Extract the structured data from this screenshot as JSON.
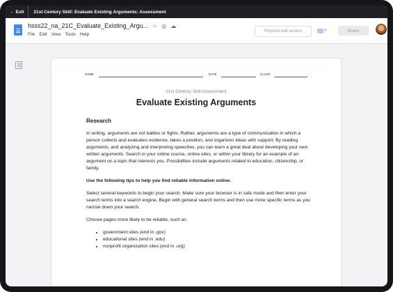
{
  "topbar": {
    "exit_label": "Exit",
    "title": "21st Century Skill: Evaluate Existing Arguments: Assessment"
  },
  "docs": {
    "filename": "hsss22_na_21C_Evaluate_Existing_Argu...",
    "menus": [
      "File",
      "Edit",
      "View",
      "Tools",
      "Help"
    ],
    "request_edit_label": "Request edit access",
    "share_label": "Share"
  },
  "document": {
    "fields": {
      "name": "NAME",
      "date": "DATE",
      "class": "CLASS"
    },
    "kicker": "21st Century Skill Assessment",
    "title": "Evaluate Existing Arguments",
    "section_heading": "Research",
    "para1": "In writing, arguments are not battles or fights. Rather, arguments are a type of communication in which a person collects and evaluates evidence, takes a position, and organizes ideas with support. By reading arguments, and analyzing and interpreting speeches, you can learn a great deal about developing your own written arguments. Search in your online course, online sites, or within your library for an example of an argument on a topic that interests you. Possibilities include arguments related to education, citizenship, or family.",
    "tips_heading": "Use the following tips to help you find reliable information online.",
    "para2": "Select several keywords to begin your search. Make sure your browser is in safe mode and then enter your search terms into a search engine. Begin with general search terms and then use more specific terms as you narrow down your search.",
    "para3": "Choose pages more likely to be reliable, such as",
    "bullets": [
      "government sites (end in .gov)",
      "educational sites (end in .edu)",
      "nonprofit organization sites (end in .org)"
    ]
  },
  "colors": {
    "docs_blue": "#4285f4",
    "topbar": "#1f1f24",
    "device_frame": "#16161a"
  },
  "icons": [
    "arrow-left-icon",
    "docs-logo-icon",
    "star-icon",
    "move-to-folder-icon",
    "cloud-status-icon",
    "comment-icon",
    "outline-icon",
    "avatar"
  ]
}
